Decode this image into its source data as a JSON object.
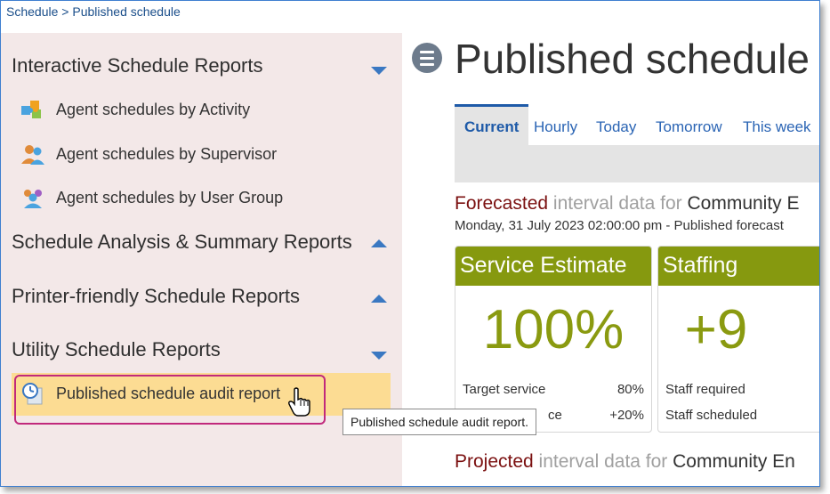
{
  "breadcrumb": {
    "root": "Schedule",
    "separator": " > ",
    "current": "Published schedule"
  },
  "sidebar": {
    "sections": [
      {
        "title": "Interactive Schedule Reports",
        "expanded": true,
        "items": [
          {
            "label": "Agent schedules by Activity",
            "icon": "puzzle-icon"
          },
          {
            "label": "Agent schedules by Supervisor",
            "icon": "supervisor-icon"
          },
          {
            "label": "Agent schedules by User Group",
            "icon": "user-group-icon"
          }
        ]
      },
      {
        "title": "Schedule Analysis & Summary Reports",
        "expanded": false
      },
      {
        "title": "Printer-friendly Schedule Reports",
        "expanded": false
      },
      {
        "title": "Utility Schedule Reports",
        "expanded": true,
        "items": [
          {
            "label": "Published schedule audit report",
            "icon": "clock-report-icon"
          }
        ]
      }
    ],
    "tooltip": "Published schedule audit report."
  },
  "main": {
    "title": "Published schedule",
    "tabs": [
      "Current",
      "Hourly",
      "Today",
      "Tomorrow",
      "This week"
    ],
    "active_tab": "Current",
    "forecast": {
      "word1": "Forecasted",
      "word2": " interval data for ",
      "word3": "Community E",
      "subtitle": "Monday, 31 July 2023 02:00:00 pm - Published forecast"
    },
    "cards": [
      {
        "title": "Service Estimate",
        "value": "100%",
        "rows": [
          {
            "label": "Target service",
            "value": "80%"
          },
          {
            "label": "ce",
            "value": "+20%"
          }
        ]
      },
      {
        "title": "Staffing",
        "value": "+9",
        "rows": [
          {
            "label": "Staff required",
            "value": ""
          },
          {
            "label": "Staff scheduled",
            "value": ""
          }
        ]
      }
    ],
    "projected": {
      "word1": "Projected",
      "word2": " interval data for ",
      "word3": "Community En"
    }
  },
  "colors": {
    "accent": "#86990f",
    "link": "#2a64b4",
    "highlight": "#fcdc93",
    "focus_border": "#c1297c"
  }
}
